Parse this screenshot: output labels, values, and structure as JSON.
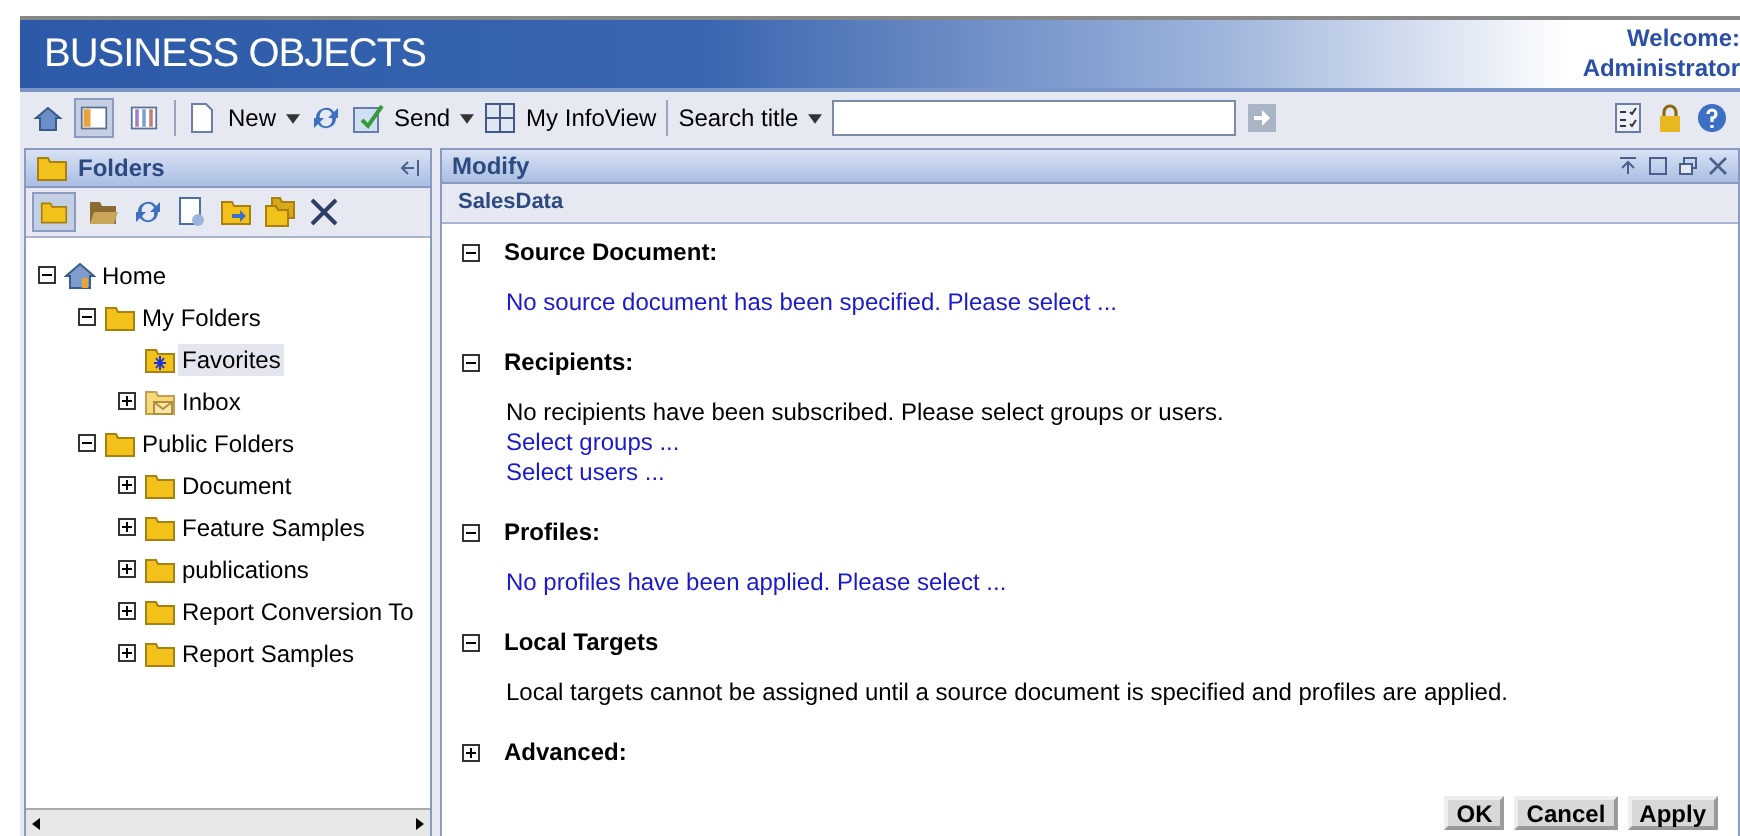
{
  "header": {
    "logo": "BUSINESS OBJECTS",
    "welcome": "Welcome:",
    "user": "Administrator"
  },
  "toolbar": {
    "view_modes": [
      {
        "selected": true
      },
      {
        "selected": false
      }
    ],
    "new": "New",
    "send": "Send",
    "my_infoview": "My InfoView",
    "search_mode": "Search title"
  },
  "folders_panel": {
    "title": "Folders",
    "tree": [
      {
        "label": "Home",
        "kind": "home",
        "expanded": true,
        "selected": false,
        "children": [
          {
            "label": "My Folders",
            "kind": "folder",
            "expanded": true,
            "selected": false,
            "children": [
              {
                "label": "Favorites",
                "kind": "favorites",
                "selected": true
              },
              {
                "label": "Inbox",
                "kind": "inbox",
                "expanded": false,
                "selected": false
              }
            ]
          },
          {
            "label": "Public Folders",
            "kind": "folder",
            "expanded": true,
            "selected": false,
            "children": [
              {
                "label": "Document",
                "kind": "folder",
                "expanded": false,
                "selected": false
              },
              {
                "label": "Feature Samples",
                "kind": "folder",
                "expanded": false,
                "selected": false
              },
              {
                "label": "publications",
                "kind": "folder",
                "expanded": false,
                "selected": false
              },
              {
                "label": "Report Conversion To",
                "kind": "folder",
                "expanded": false,
                "selected": false
              },
              {
                "label": "Report Samples",
                "kind": "folder",
                "expanded": false,
                "selected": false
              }
            ]
          }
        ]
      }
    ]
  },
  "modify_panel": {
    "title": "Modify",
    "object": "SalesData",
    "sections": [
      {
        "title": "Source Document:",
        "expanded": true,
        "lines": [
          {
            "kind": "link",
            "text": "No source document has been specified. Please select ..."
          }
        ]
      },
      {
        "title": "Recipients:",
        "expanded": true,
        "lines": [
          {
            "kind": "text",
            "text": "No recipients have been subscribed. Please select groups or users."
          },
          {
            "kind": "link",
            "text": "Select groups ..."
          },
          {
            "kind": "link",
            "text": "Select users ..."
          }
        ]
      },
      {
        "title": "Profiles:",
        "expanded": true,
        "lines": [
          {
            "kind": "link",
            "text": "No profiles have been applied. Please select ..."
          }
        ]
      },
      {
        "title": "Local Targets",
        "expanded": true,
        "lines": [
          {
            "kind": "text",
            "text": "Local targets cannot be assigned until a source document is specified and profiles are applied."
          }
        ]
      },
      {
        "title": "Advanced:",
        "expanded": false
      }
    ],
    "buttons": [
      "OK",
      "Cancel",
      "Apply"
    ]
  }
}
